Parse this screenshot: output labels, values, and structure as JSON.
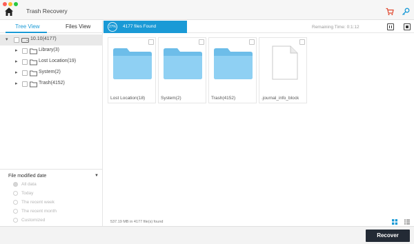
{
  "window": {
    "title": "Trash Recovery"
  },
  "sidebar": {
    "tabs": [
      {
        "label": "Tree View",
        "active": true
      },
      {
        "label": "Files View",
        "active": false
      }
    ],
    "tree": [
      {
        "label": "10.10(4177)",
        "expanded": true
      },
      {
        "label": "Library(3)"
      },
      {
        "label": "Lost Location(19)"
      },
      {
        "label": "System(2)"
      },
      {
        "label": "Trash(4152)"
      }
    ],
    "filter": {
      "title": "File modified date",
      "options": [
        "All data",
        "Today",
        "The recent week",
        "The recent month",
        "Customized"
      ],
      "selected": "All data"
    }
  },
  "scan": {
    "progress_percent": 27,
    "progress_label": "27%",
    "files_found": "4177 files Found",
    "remaining": "Remaining Time: 0:1:12"
  },
  "files": [
    {
      "label": "Lost Location(18)",
      "type": "folder-icon"
    },
    {
      "label": "System(2)",
      "type": "folder-icon"
    },
    {
      "label": "Trash(4152)",
      "type": "folder-icon"
    },
    {
      "label": ".journal_info_block",
      "type": "document-icon"
    }
  ],
  "footer": {
    "count": "537.19 MB in 4177 file(s) found",
    "recover_label": "Recover"
  },
  "colors": {
    "accent": "#1a9ad6",
    "folder": "#7cc6ee",
    "recover_button": "#232a35"
  }
}
